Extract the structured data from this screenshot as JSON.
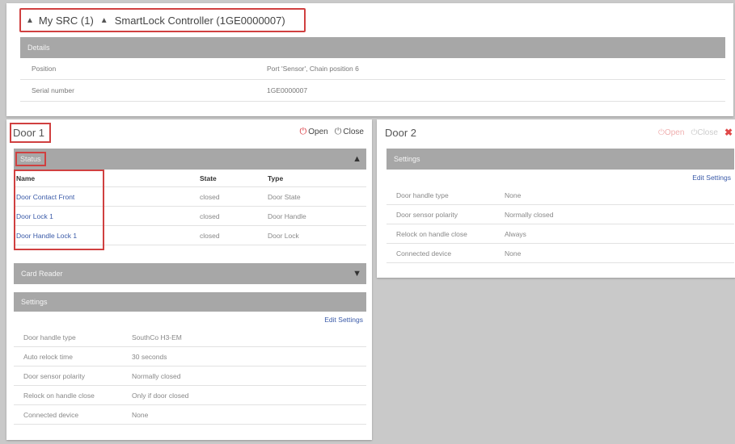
{
  "breadcrumb": {
    "item1": "My SRC (1)",
    "item2": "SmartLock Controller (1GE0000007)"
  },
  "details": {
    "header": "Details",
    "rows": [
      {
        "label": "Position",
        "value": "Port 'Sensor', Chain position 6"
      },
      {
        "label": "Serial number",
        "value": "1GE0000007"
      }
    ]
  },
  "door1": {
    "title": "Door 1",
    "open_label": "Open",
    "close_label": "Close",
    "status": {
      "header": "Status",
      "columns": {
        "name": "Name",
        "state": "State",
        "type": "Type"
      },
      "rows": [
        {
          "name": "Door Contact Front",
          "state": "closed",
          "type": "Door State"
        },
        {
          "name": "Door Lock 1",
          "state": "closed",
          "type": "Door Handle"
        },
        {
          "name": "Door Handle Lock 1",
          "state": "closed",
          "type": "Door Lock"
        }
      ]
    },
    "card_reader": {
      "header": "Card Reader"
    },
    "settings": {
      "header": "Settings",
      "edit_label": "Edit Settings",
      "rows": [
        {
          "label": "Door handle type",
          "value": "SouthCo H3-EM"
        },
        {
          "label": "Auto relock time",
          "value": "30 seconds"
        },
        {
          "label": "Door sensor polarity",
          "value": "Normally closed"
        },
        {
          "label": "Relock on handle close",
          "value": "Only if door closed"
        },
        {
          "label": "Connected device",
          "value": "None"
        }
      ]
    }
  },
  "door2": {
    "title": "Door 2",
    "open_label": "Open",
    "close_label": "Close",
    "settings": {
      "header": "Settings",
      "edit_label": "Edit Settings",
      "rows": [
        {
          "label": "Door handle type",
          "value": "None"
        },
        {
          "label": "Door sensor polarity",
          "value": "Normally closed"
        },
        {
          "label": "Relock on handle close",
          "value": "Always"
        },
        {
          "label": "Connected device",
          "value": "None"
        }
      ]
    }
  },
  "colors": {
    "accent_red": "#d9323a",
    "link_blue": "#3a5aa8",
    "header_gray": "#a7a7a7",
    "highlight_box": "#d04040"
  },
  "icons": {
    "sort": "sort-icon",
    "power": "power-icon",
    "close": "close-x-icon",
    "chevron_up": "chevron-up-icon",
    "chevron_down": "chevron-down-icon"
  }
}
